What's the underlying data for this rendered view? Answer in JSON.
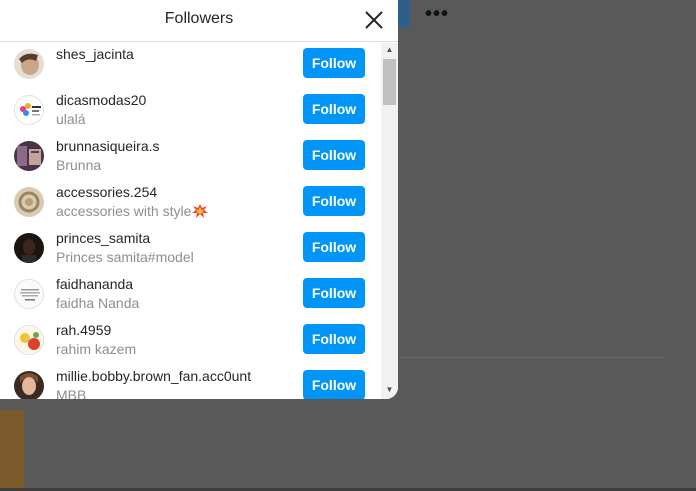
{
  "modal": {
    "title": "Followers",
    "follow_label": "Follow",
    "followers": [
      {
        "username": "shes_jacinta",
        "fullname": "",
        "avatar_color": "#d8c3b0"
      },
      {
        "username": "dicasmodas20",
        "fullname": "ulalá",
        "avatar_color": "#e9e4f0"
      },
      {
        "username": "brunnasiqueira.s",
        "fullname": "Brunna",
        "avatar_color": "#6b4a6e"
      },
      {
        "username": "accessories.254",
        "fullname": "accessories with style",
        "avatar_color": "#c9b89c"
      },
      {
        "username": "princes_samita",
        "fullname": "Princes samita#model",
        "avatar_color": "#2a1f1a"
      },
      {
        "username": "faidhananda",
        "fullname": "faidha Nanda",
        "avatar_color": "#f2f2f2"
      },
      {
        "username": "rah.4959",
        "fullname": "rahim kazem",
        "avatar_color": "#e8c04a"
      },
      {
        "username": "millie.bobby.brown_fan.acc0unt",
        "fullname": "MBB",
        "avatar_color": "#8a6d5a"
      }
    ]
  },
  "background": {
    "more_icon_label": "•••"
  },
  "scrollbar": {
    "up_arrow": "▲",
    "down_arrow": "▼"
  },
  "colors": {
    "follow_button": "#0095f6",
    "overlay": "#595959"
  }
}
